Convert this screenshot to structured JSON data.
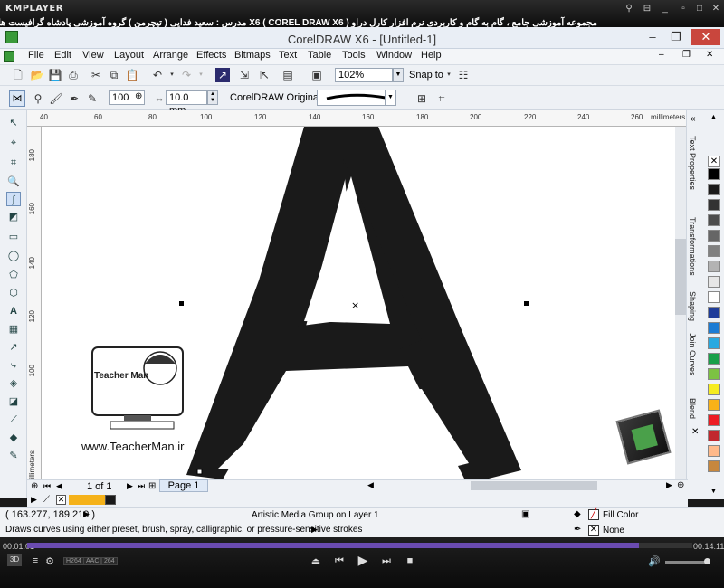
{
  "player": {
    "logo": "KMPLAYER",
    "title": "مجموعه آموزشی جامع ، گام به گام و کاربردی نرم افزار کارل دراو X6 ( COREL DRAW X6 )   مدرس : سعید فدایی ( تیچرمن ) گروه آموزشی پادشاه گرافیست ها",
    "time_elapsed": "00:01:01",
    "time_total": "00:14:11",
    "progress": 0.92,
    "chips": [
      "H264",
      "AAC",
      "264"
    ]
  },
  "window": {
    "title": "CorelDRAW X6 - [Untitled-1]"
  },
  "menu": [
    "File",
    "Edit",
    "View",
    "Layout",
    "Arrange",
    "Effects",
    "Bitmaps",
    "Text",
    "Table",
    "Tools",
    "Window",
    "Help"
  ],
  "toolbar": {
    "zoom": "102%",
    "snap_to": "Snap to"
  },
  "property_bar": {
    "size_value": "100",
    "width_value": "10.0 mm",
    "preset_label": "CorelDRAW Originals"
  },
  "ruler": {
    "h_ticks": [
      "40",
      "60",
      "80",
      "100",
      "120",
      "140",
      "160",
      "180",
      "200",
      "220",
      "240",
      "260"
    ],
    "h_unit": "millimeters",
    "v_ticks": [
      "180",
      "160",
      "140",
      "120",
      "100"
    ],
    "v_unit": "millimeters"
  },
  "canvas": {
    "watermark_text": "www.TeacherMan.ir",
    "logo_text": "Teacher Man"
  },
  "pager": {
    "page_count": "1 of 1",
    "page_tab": "Page 1"
  },
  "docker_tabs": [
    "Text Properties",
    "Transformations",
    "Shaping",
    "Join Curves",
    "Blend"
  ],
  "palette_colors": [
    "#000000",
    "#1a1a1a",
    "#333333",
    "#4d4d4d",
    "#666666",
    "#808080",
    "#b3b3b3",
    "#e6e6e6",
    "#ffffff",
    "#1f3c99",
    "#1c7cd4",
    "#29a9e0",
    "#19a04a",
    "#7cc242",
    "#f6ec21",
    "#f8b219",
    "#ed1c24",
    "#c1272d",
    "#ffb98a",
    "#c7873d"
  ],
  "doc_palette": [
    "#f5b21a",
    "#f5b21a",
    "#f5b21a",
    "#f5b21a"
  ],
  "status": {
    "coords": "( 163.277, 189.219 )",
    "object_info": "Artistic Media Group on Layer 1",
    "fill_label": "Fill Color",
    "outline_label": "None",
    "hint": "Draws curves using either preset, brush, spray, calligraphic, or pressure-sensitive strokes"
  }
}
